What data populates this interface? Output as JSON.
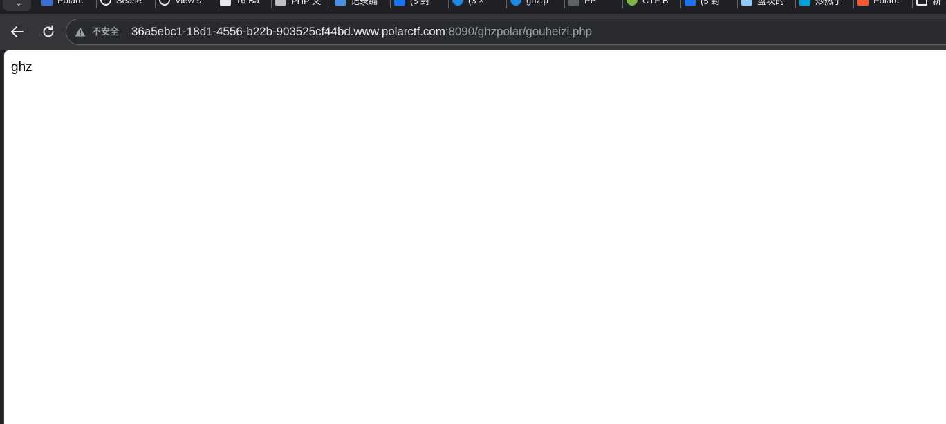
{
  "browser": {
    "tabs": [
      {
        "title": "Polarc",
        "icon": "polarctf-icon",
        "color": "#3b6fd6"
      },
      {
        "title": "Sease",
        "icon": "globe-icon",
        "color": "#e8eaed"
      },
      {
        "title": "View s",
        "icon": "globe-icon",
        "color": "#e8eaed"
      },
      {
        "title": "16 Ba",
        "icon": "document-icon",
        "color": "#e8eaed"
      },
      {
        "title": "PHP 文",
        "icon": "php-doc-icon",
        "color": "#c0c0c0"
      },
      {
        "title": "记录编",
        "icon": "feather-icon",
        "color": "#4a90e2"
      },
      {
        "title": "(5 封",
        "icon": "zhihu-icon",
        "color": "#1772f6"
      },
      {
        "title": "(3 ×",
        "icon": "blue-circle-icon",
        "color": "#1e88e5"
      },
      {
        "title": "ghz.p",
        "icon": "blue-circle-icon",
        "color": "#1e88e5"
      },
      {
        "title": "PP",
        "icon": "dark-doc-icon",
        "color": "#5f6368"
      },
      {
        "title": "CTF B",
        "icon": "green-circle-icon",
        "color": "#7cb342"
      },
      {
        "title": "(5 封",
        "icon": "zhihu-icon",
        "color": "#1772f6"
      },
      {
        "title": "盘块的",
        "icon": "image-icon",
        "color": "#90caf9"
      },
      {
        "title": "炒热乎",
        "icon": "tv-icon",
        "color": "#00a1d6"
      },
      {
        "title": "Polarc",
        "icon": "csdn-icon",
        "color": "#fc5531"
      },
      {
        "title": "新",
        "icon": "window-icon",
        "color": "#e8eaed"
      }
    ],
    "security_label": "不安全",
    "url": {
      "host": "36a5ebc1-18d1-4556-b22b-903525cf44bd.www.polarctf.com",
      "rest": ":8090/ghzpolar/gouheizi.php"
    }
  },
  "page": {
    "body_text": "ghz"
  },
  "colors": {
    "toolbar_bg": "#35363a",
    "omnibox_bg": "#282a2d",
    "page_bg": "#ffffff"
  }
}
